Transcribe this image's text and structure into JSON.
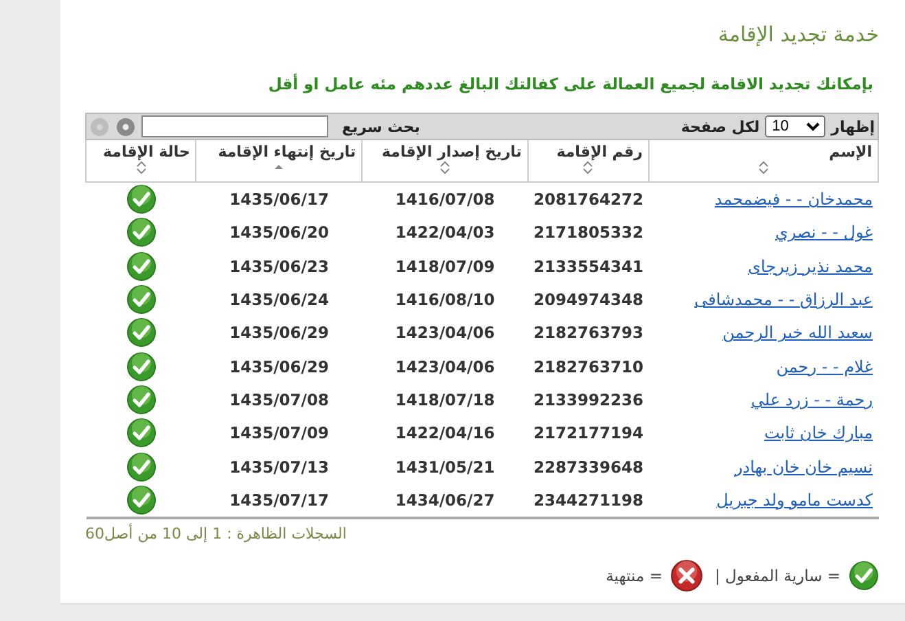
{
  "title": "خدمة تجديد الإقامة",
  "notice": "بإمكانك تجديد الاقامة لجميع العمالة على كفالتك البالغ عددهم مئه عامل او أقل",
  "toolbar": {
    "show_label": "إظهار",
    "page_size": "10",
    "per_page_label": "لكل صفحة",
    "search_label": "بحث سريع",
    "prev_disabled": true,
    "next_disabled": false
  },
  "table": {
    "columns": [
      {
        "label": "الإسم",
        "sorted": false
      },
      {
        "label": "رقم الإقامة",
        "sorted": false
      },
      {
        "label": "تاريخ إصدار الإقامة",
        "sorted": false
      },
      {
        "label": "تاريخ إنتهاء الإقامة",
        "sorted": true
      },
      {
        "label": "حالة الإقامة",
        "sorted": false
      }
    ],
    "rows": [
      {
        "name": "محمدخان - - فيضمحمد",
        "iqama": "2081764272",
        "issued": "1416/07/08",
        "expires": "1435/06/17",
        "kind": "valid"
      },
      {
        "name": "غول - - نصري",
        "iqama": "2171805332",
        "issued": "1422/04/03",
        "expires": "1435/06/20",
        "kind": "valid"
      },
      {
        "name": "محمد نذير زيرجاى",
        "iqama": "2133554341",
        "issued": "1418/07/09",
        "expires": "1435/06/23",
        "kind": "valid"
      },
      {
        "name": "عبد الرزاق - - محمدشافى",
        "iqama": "2094974348",
        "issued": "1416/08/10",
        "expires": "1435/06/24",
        "kind": "valid"
      },
      {
        "name": "سعيد الله خير الرحمن",
        "iqama": "2182763793",
        "issued": "1423/04/06",
        "expires": "1435/06/29",
        "kind": "valid"
      },
      {
        "name": "غلام - - رحمن",
        "iqama": "2182763710",
        "issued": "1423/04/06",
        "expires": "1435/06/29",
        "kind": "valid"
      },
      {
        "name": "رحمة - - زرد علي",
        "iqama": "2133992236",
        "issued": "1418/07/18",
        "expires": "1435/07/08",
        "kind": "valid"
      },
      {
        "name": "مبارك خان ثابت",
        "iqama": "2172177194",
        "issued": "1422/04/16",
        "expires": "1435/07/09",
        "kind": "valid"
      },
      {
        "name": "نسيم خان خان بهادر",
        "iqama": "2287339648",
        "issued": "1431/05/21",
        "expires": "1435/07/13",
        "kind": "valid"
      },
      {
        "name": "كدست مامو ولد جبريل",
        "iqama": "2344271198",
        "issued": "1434/06/27",
        "expires": "1435/07/17",
        "kind": "valid"
      }
    ]
  },
  "records_info": "السجلات الظاهرة : 1 إلى 10 من أصل60",
  "legend": [
    {
      "kind": "valid",
      "label": "= سارية المفعول |"
    },
    {
      "kind": "expired",
      "label": "= منتهية"
    }
  ]
}
